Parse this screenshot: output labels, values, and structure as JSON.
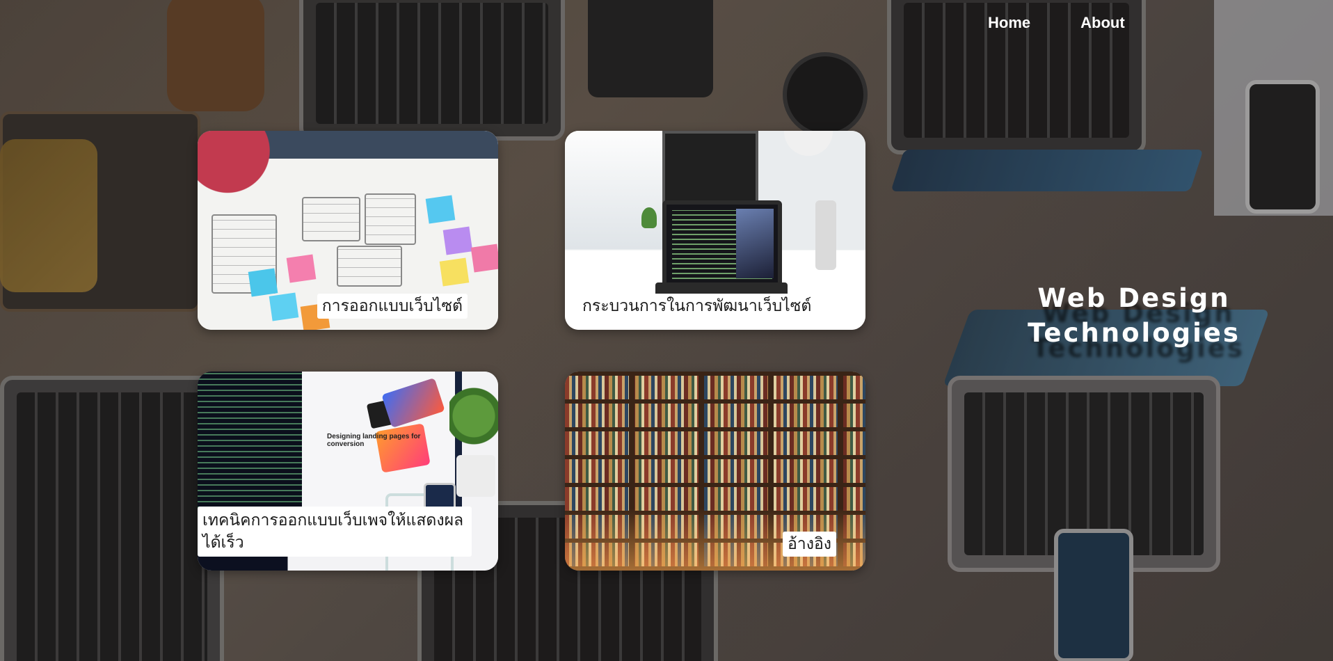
{
  "nav": {
    "items": [
      {
        "label": "Home"
      },
      {
        "label": "About"
      }
    ]
  },
  "hero": {
    "title_line_1": "Web Design",
    "title_line_2": "Technologies"
  },
  "cards": [
    {
      "label": "การออกแบบเว็บไซต์",
      "image": "paper-wireframe-sketch-photo"
    },
    {
      "label": "กระบวนการในการพัฒนาเว็บไซต์",
      "image": "laptop-desk-code-photo"
    },
    {
      "label": "เทคนิคการออกแบบเว็บเพจให้แสดงผลได้เร็ว",
      "image": "designing-landing-pages-monitor-photo",
      "image_text": "Designing landing pages for conversion"
    },
    {
      "label": "อ้างอิง",
      "image": "library-bookshelf-photo"
    }
  ],
  "colors": {
    "nav_text": "#ffffff",
    "hero_text": "#ffffff",
    "label_bg": "#ffffff",
    "label_text": "#1a1a1a"
  }
}
